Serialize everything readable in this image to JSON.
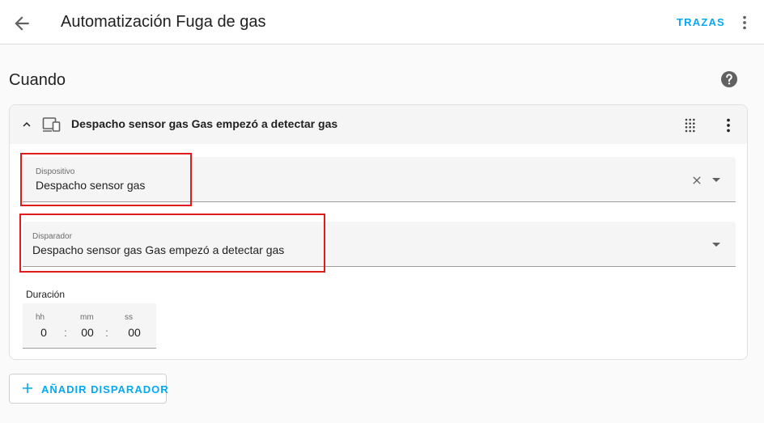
{
  "header": {
    "title": "Automatización Fuga de gas",
    "traces_label": "TRAZAS"
  },
  "section": {
    "title": "Cuando"
  },
  "trigger_card": {
    "title": "Despacho sensor gas Gas empezó a detectar gas",
    "device_field": {
      "label": "Dispositivo",
      "value": "Despacho sensor gas"
    },
    "trigger_field": {
      "label": "Disparador",
      "value": "Despacho sensor gas Gas empezó a detectar gas"
    },
    "duration": {
      "label": "Duración",
      "hours_label": "hh",
      "hours": "0",
      "minutes_label": "mm",
      "minutes": "00",
      "seconds_label": "ss",
      "seconds": "00",
      "separator": ":"
    }
  },
  "add_trigger_button": {
    "label": "AÑADIR DISPARADOR"
  },
  "colors": {
    "accent": "#03a9f4",
    "highlight": "#e01b1b"
  }
}
